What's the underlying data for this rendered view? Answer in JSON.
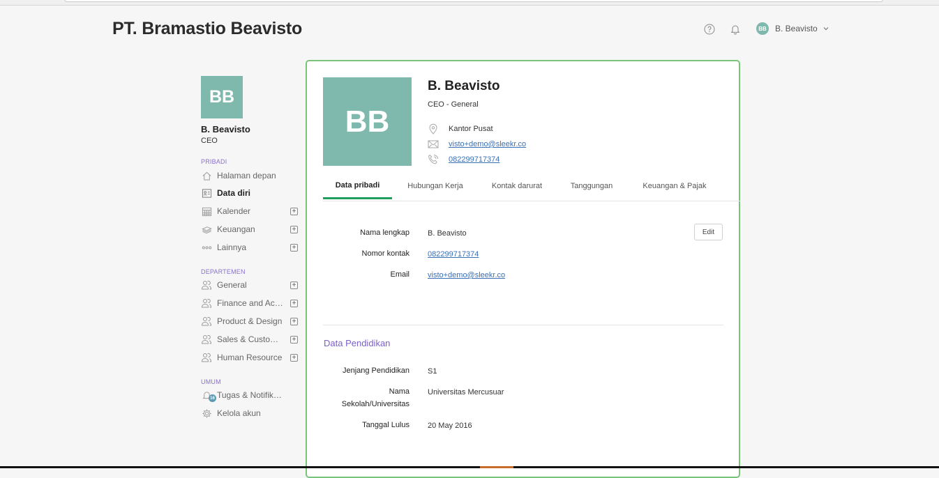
{
  "header": {
    "company": "PT. Bramastio Beavisto",
    "user_initials": "BB",
    "user_name": "B. Beavisto",
    "icons": [
      "help-icon",
      "bell-icon",
      "chevron-down-icon"
    ]
  },
  "sidebar": {
    "avatar_initials": "BB",
    "name": "B. Beavisto",
    "role": "CEO",
    "sections": {
      "pribadi": "PRIBADI",
      "departemen": "DEPARTEMEN",
      "umum": "UMUM"
    },
    "pribadi_items": [
      {
        "label": "Halaman depan",
        "icon": "home-icon"
      },
      {
        "label": "Data diri",
        "icon": "id-card-icon",
        "active": true
      },
      {
        "label": "Kalender",
        "icon": "calendar-icon",
        "expandable": true
      },
      {
        "label": "Keuangan",
        "icon": "money-icon",
        "expandable": true
      },
      {
        "label": "Lainnya",
        "icon": "more-icon",
        "expandable": true
      }
    ],
    "departemen_items": [
      {
        "label": "General",
        "icon": "people-icon"
      },
      {
        "label": "Finance and Accounting",
        "icon": "people-icon"
      },
      {
        "label": "Product & Design",
        "icon": "people-icon"
      },
      {
        "label": "Sales & Customer Service",
        "icon": "people-icon"
      },
      {
        "label": "Human Resource",
        "icon": "people-icon"
      }
    ],
    "umum_items": [
      {
        "label": "Tugas & Notifikasi",
        "icon": "bell-icon",
        "badge": "16"
      },
      {
        "label": "Kelola akun",
        "icon": "gear-icon"
      }
    ],
    "expand_symbol": "+"
  },
  "profile": {
    "initials": "BB",
    "name": "B. Beavisto",
    "role": "CEO - General",
    "location": "Kantor Pusat",
    "email": "visto+demo@sleekr.co",
    "phone": "082299717374"
  },
  "tabs": [
    {
      "label": "Data pribadi",
      "active": true
    },
    {
      "label": "Hubungan Kerja"
    },
    {
      "label": "Kontak darurat"
    },
    {
      "label": "Tanggungan"
    },
    {
      "label": "Keuangan & Pajak"
    }
  ],
  "personal": {
    "edit_label": "Edit",
    "rows": [
      {
        "label": "Nama lengkap",
        "value": "B. Beavisto"
      },
      {
        "label": "Nomor kontak",
        "value": "082299717374"
      },
      {
        "label": "Email",
        "value": "visto+demo@sleekr.co"
      }
    ]
  },
  "education": {
    "title": "Data Pendidikan",
    "rows": [
      {
        "label": "Jenjang Pendidikan",
        "value": "S1"
      },
      {
        "label": "Nama Sekolah/Universitas",
        "value": "Universitas Mercusuar"
      },
      {
        "label": "Tanggal Lulus",
        "value": "20 May 2016"
      }
    ]
  },
  "colors": {
    "avatar": "#7fb8ac",
    "card_border": "#7ac47a",
    "tab_active": "#1e9e5b",
    "section_label": "#8a6fd1",
    "link": "#3a6fb5"
  }
}
